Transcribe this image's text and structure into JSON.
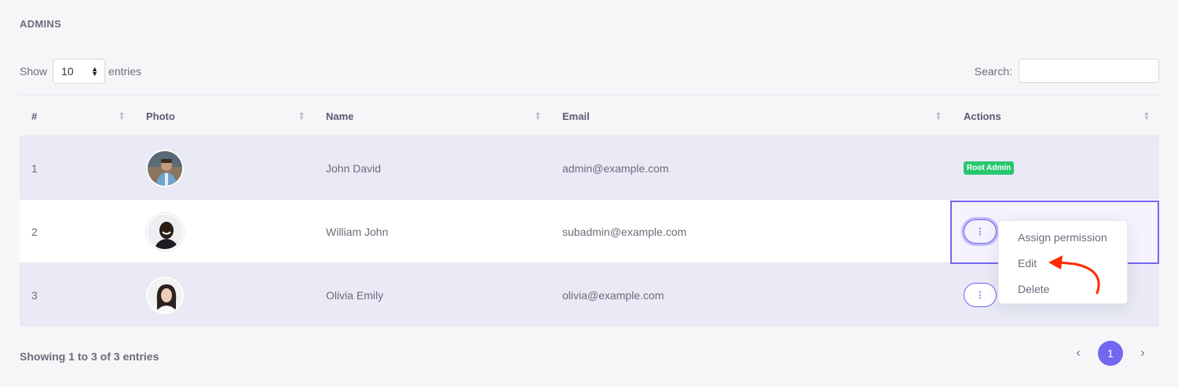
{
  "card_title": "ADMINS",
  "length_menu": {
    "prefix": "Show",
    "value": "10",
    "suffix": "entries"
  },
  "search": {
    "label": "Search:",
    "value": ""
  },
  "columns": [
    "#",
    "Photo",
    "Name",
    "Email",
    "Actions"
  ],
  "rows": [
    {
      "index": "1",
      "photo": "John David avatar",
      "name": "John David",
      "email": "admin@example.com",
      "action_badge": "Root Admin"
    },
    {
      "index": "2",
      "photo": "William John avatar",
      "name": "William John",
      "email": "subadmin@example.com"
    },
    {
      "index": "3",
      "photo": "Olivia Emily avatar",
      "name": "Olivia Emily",
      "email": "olivia@example.com"
    }
  ],
  "actions_menu": {
    "items": [
      "Assign permission",
      "Edit",
      "Delete"
    ]
  },
  "footer": {
    "info": "Showing 1 to 3 of 3 entries",
    "prev": "‹",
    "current_page": "1",
    "next": "›"
  },
  "colors": {
    "accent": "#7367f0",
    "success": "#28c76f",
    "annotation_arrow": "#ff2a00"
  }
}
